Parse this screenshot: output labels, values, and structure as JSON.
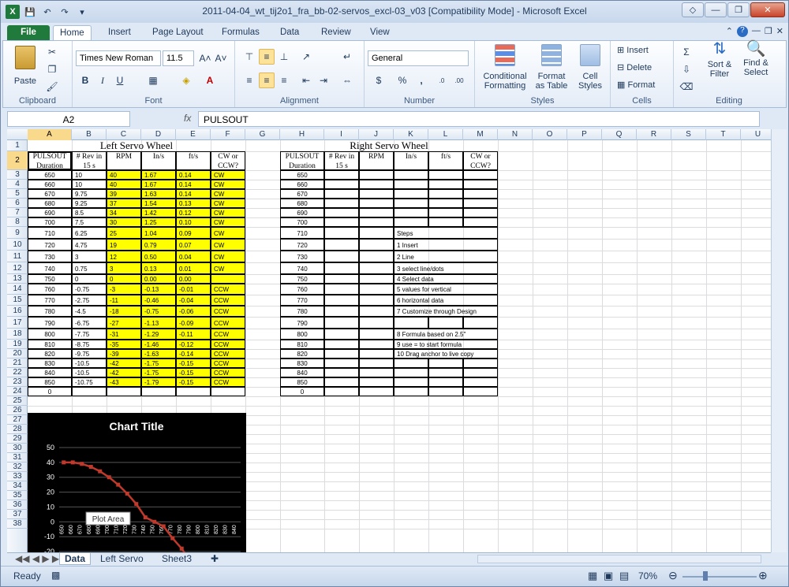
{
  "window": {
    "title": "2011-04-04_wt_tij2o1_fra_bb-02-servos_excl-03_v03  [Compatibility Mode]  -  Microsoft Excel"
  },
  "tabs": [
    "File",
    "Home",
    "Insert",
    "Page Layout",
    "Formulas",
    "Data",
    "Review",
    "View"
  ],
  "ribbon": {
    "clipboard": {
      "label": "Clipboard",
      "paste": "Paste"
    },
    "font": {
      "label": "Font",
      "name": "Times New Roman",
      "size": "11.5"
    },
    "alignment": {
      "label": "Alignment"
    },
    "number": {
      "label": "Number",
      "format": "General"
    },
    "styles": {
      "label": "Styles",
      "cond": "Conditional Formatting",
      "table": "Format as Table",
      "cell": "Cell Styles"
    },
    "cells": {
      "label": "Cells",
      "insert": "Insert",
      "delete": "Delete",
      "format": "Format"
    },
    "editing": {
      "label": "Editing",
      "sort": "Sort & Filter",
      "find": "Find & Select"
    }
  },
  "formula": {
    "namebox": "A2",
    "value": "PULSOUT"
  },
  "columns": [
    "A",
    "B",
    "C",
    "D",
    "E",
    "F",
    "G",
    "H",
    "I",
    "J",
    "K",
    "L",
    "M",
    "N",
    "O",
    "P",
    "Q",
    "R",
    "S",
    "T",
    "U"
  ],
  "left": {
    "title": "Left Servo Wheel",
    "headers": [
      "PULSOUT Duration",
      "# Rev in 15 s",
      "RPM",
      "In/s",
      "ft/s",
      "CW or CCW?"
    ],
    "rows": [
      [
        "650",
        "10",
        "40",
        "1.67",
        "0.14",
        "CW"
      ],
      [
        "660",
        "10",
        "40",
        "1.67",
        "0.14",
        "CW"
      ],
      [
        "670",
        "9.75",
        "39",
        "1.63",
        "0.14",
        "CW"
      ],
      [
        "680",
        "9.25",
        "37",
        "1.54",
        "0.13",
        "CW"
      ],
      [
        "690",
        "8.5",
        "34",
        "1.42",
        "0.12",
        "CW"
      ],
      [
        "700",
        "7.5",
        "30",
        "1.25",
        "0.10",
        "CW"
      ],
      [
        "710",
        "6.25",
        "25",
        "1.04",
        "0.09",
        "CW"
      ],
      [
        "720",
        "4.75",
        "19",
        "0.79",
        "0.07",
        "CW"
      ],
      [
        "730",
        "3",
        "12",
        "0.50",
        "0.04",
        "CW"
      ],
      [
        "740",
        "0.75",
        "3",
        "0.13",
        "0.01",
        "CW"
      ],
      [
        "750",
        "0",
        "0",
        "0.00",
        "0.00",
        ""
      ],
      [
        "760",
        "-0.75",
        "-3",
        "-0.13",
        "-0.01",
        "CCW"
      ],
      [
        "770",
        "-2.75",
        "-11",
        "-0.46",
        "-0.04",
        "CCW"
      ],
      [
        "780",
        "-4.5",
        "-18",
        "-0.75",
        "-0.06",
        "CCW"
      ],
      [
        "790",
        "-6.75",
        "-27",
        "-1.13",
        "-0.09",
        "CCW"
      ],
      [
        "800",
        "-7.75",
        "-31",
        "-1.29",
        "-0.11",
        "CCW"
      ],
      [
        "810",
        "-8.75",
        "-35",
        "-1.46",
        "-0.12",
        "CCW"
      ],
      [
        "820",
        "-9.75",
        "-39",
        "-1.63",
        "-0.14",
        "CCW"
      ],
      [
        "830",
        "-10.5",
        "-42",
        "-1.75",
        "-0.15",
        "CCW"
      ],
      [
        "840",
        "-10.5",
        "-42",
        "-1.75",
        "-0.15",
        "CCW"
      ],
      [
        "850",
        "-10.75",
        "-43",
        "-1.79",
        "-0.15",
        "CCW"
      ],
      [
        "0",
        "",
        "",
        "",
        "",
        ""
      ]
    ]
  },
  "right": {
    "title": "Right Servo Wheel",
    "headers": [
      "PULSOUT Duration",
      "# Rev in 15 s",
      "RPM",
      "In/s",
      "ft/s",
      "CW or CCW?"
    ],
    "pulsout": [
      "650",
      "660",
      "670",
      "680",
      "690",
      "700",
      "710",
      "720",
      "730",
      "740",
      "750",
      "760",
      "770",
      "780",
      "790",
      "800",
      "810",
      "820",
      "830",
      "840",
      "850",
      "0"
    ],
    "steps": [
      "",
      "",
      "",
      "",
      "",
      "",
      "Steps",
      "1 Insert",
      "2 Line",
      "3 select line/dots",
      "4 Select data",
      "5 values for vertical",
      "6 horizontal data",
      "7 Customize through Design",
      "",
      "8 Formula  based on 2.5\"",
      "9 use = to start formula",
      "10 Drag anchor to live copy",
      "",
      "",
      "",
      ""
    ]
  },
  "chart_data": {
    "type": "line",
    "title": "Chart Title",
    "categories": [
      "650",
      "660",
      "670",
      "680",
      "690",
      "700",
      "710",
      "720",
      "730",
      "740",
      "750",
      "760",
      "770",
      "780",
      "790",
      "800",
      "810",
      "820",
      "830",
      "840"
    ],
    "series": [
      {
        "values": [
          40,
          40,
          39,
          37,
          34,
          30,
          25,
          19,
          12,
          3,
          0,
          -3,
          -11,
          -18,
          -27,
          -31,
          -35,
          -39,
          -42,
          -42
        ]
      }
    ],
    "yticks": [
      "50",
      "40",
      "30",
      "20",
      "10",
      "0",
      "-10",
      "-20"
    ],
    "ylim": [
      -20,
      50
    ],
    "tooltip": "Plot Area",
    "colors": {
      "line": "#c0392b",
      "bg": "#000000",
      "grid": "#555555"
    }
  },
  "sheets": [
    "Data",
    "Left Servo",
    "Sheet3"
  ],
  "status": {
    "ready": "Ready",
    "zoom": "70%"
  }
}
